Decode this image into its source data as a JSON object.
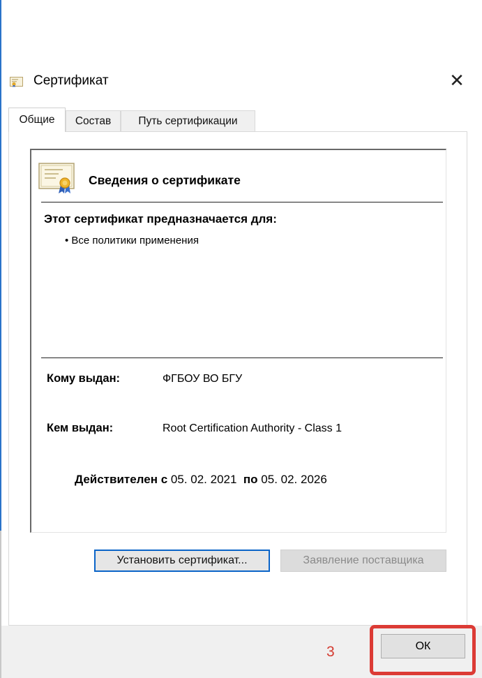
{
  "window": {
    "title": "Сертификат",
    "close_symbol": "✕",
    "icon": "certificate-icon"
  },
  "tabs": [
    {
      "label": "Общие",
      "active": true
    },
    {
      "label": "Состав",
      "active": false
    },
    {
      "label": "Путь сертификации",
      "active": false
    }
  ],
  "certificate": {
    "icon": "certificate-ribbon-icon",
    "info_heading": "Сведения о сертификате",
    "purpose_heading": "Этот сертификат предназначается для:",
    "purposes": [
      "• Все политики применения"
    ],
    "issued_to_label": "Кому выдан:",
    "issued_to_value": "ФГБОУ ВО БГУ",
    "issued_by_label": "Кем выдан:",
    "issued_by_value": "Root Certification Authority - Class 1",
    "valid_from_label": "Действителен с",
    "valid_from": "05. 02. 2021",
    "valid_to_label": "по",
    "valid_to": "05. 02. 2026"
  },
  "buttons": {
    "install": "Установить сертификат...",
    "issuer_statement": "Заявление поставщика",
    "ok": "ОК"
  },
  "annotation": {
    "step_number": "3",
    "highlight_color": "#dc3b35"
  },
  "colors": {
    "accent_blue": "#0a64c8",
    "annotation_red": "#dc3b35",
    "footer_bg": "#f0f0f0"
  }
}
